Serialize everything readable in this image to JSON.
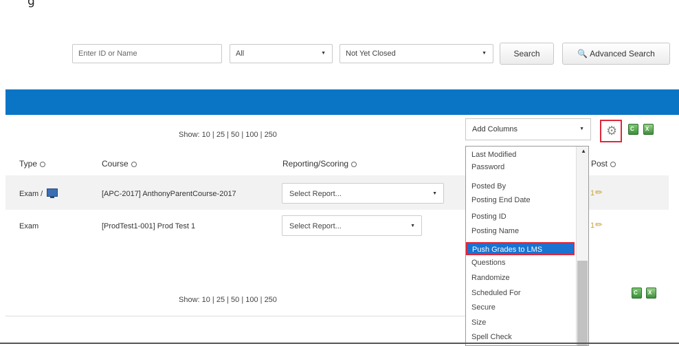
{
  "top_fragment": "g",
  "search": {
    "id_placeholder": "Enter ID or Name",
    "filter_value": "All",
    "status_value": "Not Yet Closed",
    "search_label": "Search",
    "advanced_label": "Advanced Search"
  },
  "show_top": "Show: 10 | 25 | 50 | 100 | 250",
  "show_bottom": "Show: 10 | 25 | 50 | 100 | 250",
  "columns": {
    "type": "Type",
    "course": "Course",
    "reporting": "Reporting/Scoring",
    "post": "Post"
  },
  "rows": [
    {
      "type": "Exam /",
      "course": "[APC-2017] AnthonyParentCourse-2017",
      "report": "Select Report...",
      "post_num": "1"
    },
    {
      "type": "Exam",
      "course": "[ProdTest1-001] Prod Test 1",
      "report": "Select Report...",
      "post_num": "1"
    }
  ],
  "add_columns": {
    "label": "Add Columns",
    "items": [
      "Last Modified",
      "Password",
      "Posted By",
      "Posting End Date",
      "Posting ID",
      "Posting Name",
      "Push Grades to LMS",
      "Questions",
      "Randomize",
      "Scheduled For",
      "Secure",
      "Size",
      "Spell Check"
    ],
    "highlighted": "Push Grades to LMS"
  },
  "colors": {
    "blue_bar": "#0a75c5",
    "highlight": "#1a73d0",
    "red_outline": "#e0263a"
  }
}
